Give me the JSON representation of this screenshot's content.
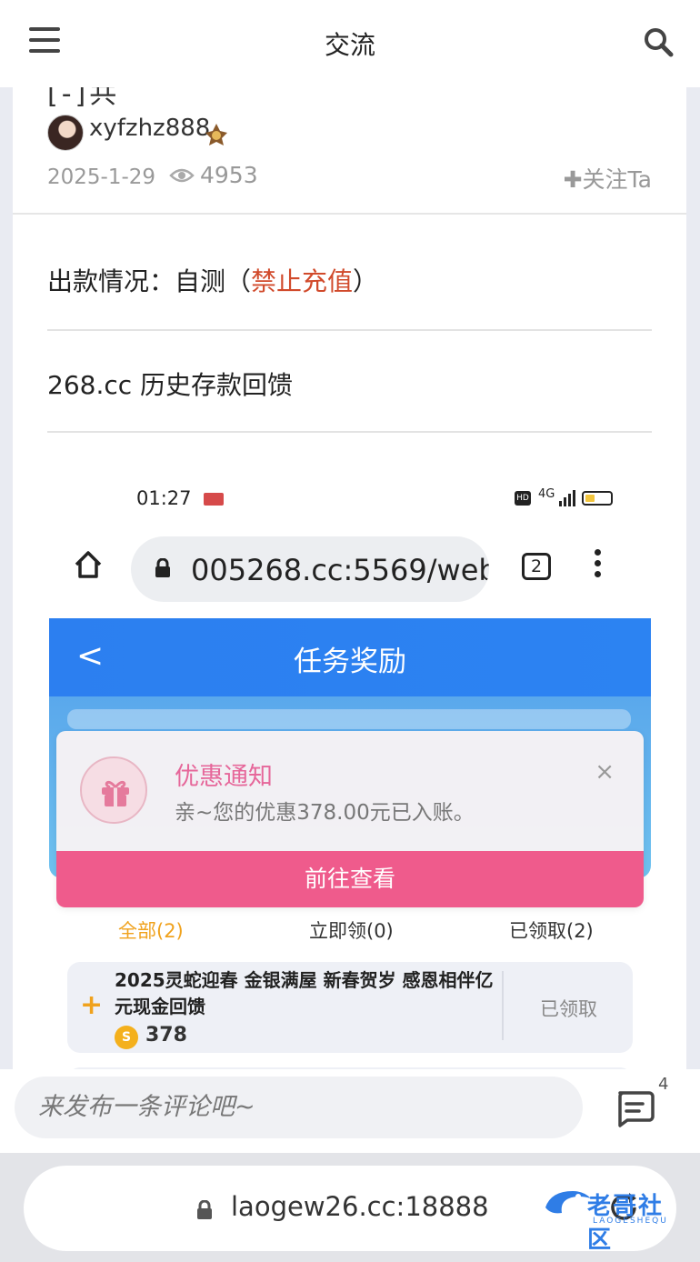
{
  "header": {
    "title": "交流",
    "menu_icon": "menu-icon",
    "search_icon": "search-icon"
  },
  "post": {
    "title_fragment": "[-]共",
    "author": "xyfzhz888",
    "date": "2025-1-29",
    "views": "4953",
    "follow_label": "关注Ta",
    "line1_prefix": "出款情况：自测（",
    "line1_highlight": "禁止充值",
    "line1_suffix": "）",
    "line2": "268.cc 历史存款回馈"
  },
  "screenshot": {
    "time": "01:27",
    "network": "4G",
    "url": "005268.cc:5569/web",
    "tab_count": "2",
    "page_title": "任务奖励",
    "back_glyph": "<",
    "modal": {
      "title": "优惠通知",
      "message": "亲~您的优惠378.00元已入账。",
      "close": "×",
      "button": "前往查看"
    },
    "filters": [
      "全部(2)",
      "立即领(0)",
      "已领取(2)"
    ],
    "task": {
      "text": "2025灵蛇迎春 金银满屋 新春贺岁 感恩相伴亿元现金回馈",
      "amount": "378",
      "coin": "S",
      "status": "已领取"
    }
  },
  "comment_bar": {
    "placeholder": "来发布一条评论吧~",
    "count": "4"
  },
  "browser": {
    "url": "laogew26.cc:18888",
    "logo_text": "老哥社区",
    "logo_sub": "LAOGESHEQU"
  },
  "colors": {
    "accent_red": "#d14a2b",
    "blue": "#2c7ff0",
    "pink": "#ef5b8c",
    "orange": "#f0a21d"
  }
}
